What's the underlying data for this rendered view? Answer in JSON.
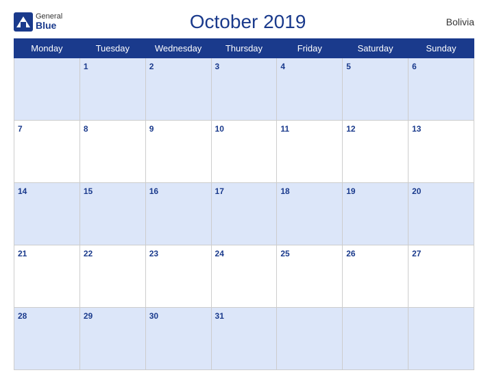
{
  "header": {
    "logo_general": "General",
    "logo_blue": "Blue",
    "month_title": "October 2019",
    "country": "Bolivia"
  },
  "days_of_week": [
    "Monday",
    "Tuesday",
    "Wednesday",
    "Thursday",
    "Friday",
    "Saturday",
    "Sunday"
  ],
  "weeks": [
    [
      null,
      1,
      2,
      3,
      4,
      5,
      6
    ],
    [
      7,
      8,
      9,
      10,
      11,
      12,
      13
    ],
    [
      14,
      15,
      16,
      17,
      18,
      19,
      20
    ],
    [
      21,
      22,
      23,
      24,
      25,
      26,
      27
    ],
    [
      28,
      29,
      30,
      31,
      null,
      null,
      null
    ]
  ]
}
